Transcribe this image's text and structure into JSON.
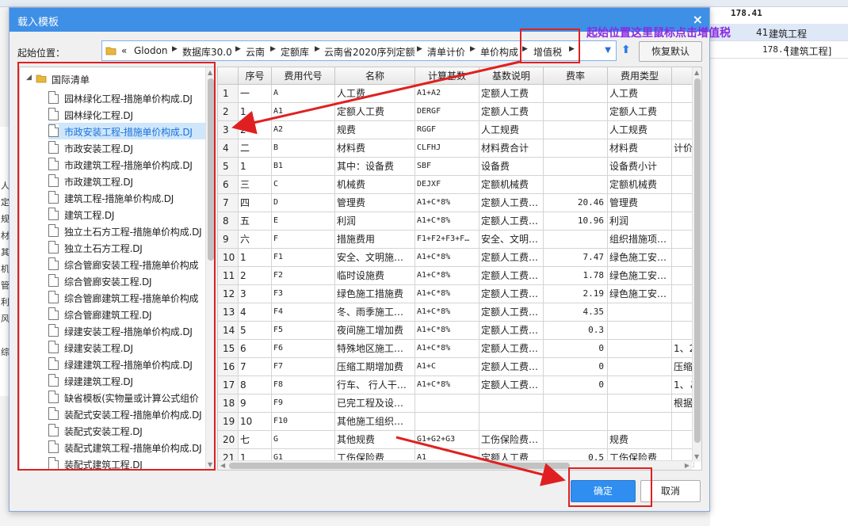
{
  "background": {
    "top_value": "178.41",
    "rows": [
      {
        "a": "41",
        "b": "建筑工程"
      },
      {
        "a": "178.4",
        "b": "[建筑工程]"
      }
    ],
    "left_labels": [
      "人",
      "定",
      "规",
      "材",
      "其",
      "机",
      "管",
      "利",
      "风",
      "",
      "综"
    ]
  },
  "dialog": {
    "title": "载入模板",
    "close_glyph": "×",
    "start_label": "起始位置：",
    "path": [
      "«",
      "Glodon",
      "数据库30.0",
      "云南",
      "定额库",
      "云南省2020序列定额",
      "清单计价",
      "单价构成",
      "增值税"
    ],
    "restore_label": "恢复默认",
    "ok_label": "确定",
    "cancel_label": "取消"
  },
  "tree": {
    "root": "国际清单",
    "items": [
      "园林绿化工程-措施单价构成.DJ",
      "园林绿化工程.DJ",
      "市政安装工程-措施单价构成.DJ",
      "市政安装工程.DJ",
      "市政建筑工程-措施单价构成.DJ",
      "市政建筑工程.DJ",
      "建筑工程-措施单价构成.DJ",
      "建筑工程.DJ",
      "独立土石方工程-措施单价构成.DJ",
      "独立土石方工程.DJ",
      "综合管廊安装工程-措施单价构成",
      "综合管廊安装工程.DJ",
      "综合管廊建筑工程-措施单价构成",
      "综合管廊建筑工程.DJ",
      "绿建安装工程-措施单价构成.DJ",
      "绿建安装工程.DJ",
      "绿建建筑工程-措施单价构成.DJ",
      "绿建建筑工程.DJ",
      "缺省模板(实物量或计算公式组价",
      "装配式安装工程-措施单价构成.DJ",
      "装配式安装工程.DJ",
      "装配式建筑工程-措施单价构成.DJ",
      "装配式建筑工程.DJ"
    ],
    "selected_index": 2
  },
  "grid": {
    "headers": [
      "序号",
      "费用代号",
      "名称",
      "计算基数",
      "基数说明",
      "费率",
      "费用类型",
      ""
    ],
    "rows": [
      [
        "1",
        "一",
        "A",
        "人工费",
        "A1+A2",
        "定额人工费",
        "",
        "人工费",
        ""
      ],
      [
        "2",
        "1",
        "A1",
        "定额人工费",
        "DERGF",
        "定额人工费",
        "",
        "定额人工费",
        ""
      ],
      [
        "3",
        "2",
        "A2",
        "规费",
        "RGGF",
        "人工规费",
        "",
        "人工规费",
        ""
      ],
      [
        "4",
        "二",
        "B",
        "材料费",
        "CLFHJ",
        "材料费合计",
        "",
        "材料费",
        "计价"
      ],
      [
        "5",
        "1",
        "B1",
        "其中：设备费",
        "SBF",
        "设备费",
        "",
        "设备费小计",
        ""
      ],
      [
        "6",
        "三",
        "C",
        "机械费",
        "DEJXF",
        "定额机械费",
        "",
        "定额机械费",
        ""
      ],
      [
        "7",
        "四",
        "D",
        "管理费",
        "A1+C*8%",
        "定额人工费…",
        "20.46",
        "管理费",
        ""
      ],
      [
        "8",
        "五",
        "E",
        "利润",
        "A1+C*8%",
        "定额人工费…",
        "10.96",
        "利润",
        ""
      ],
      [
        "9",
        "六",
        "F",
        "措施费用",
        "F1+F2+F3+F…",
        "安全、文明…",
        "",
        "组织措施项…",
        ""
      ],
      [
        "10",
        "1",
        "F1",
        "安全、文明施…",
        "A1+C*8%",
        "定额人工费…",
        "7.47",
        "绿色施工安…",
        ""
      ],
      [
        "11",
        "2",
        "F2",
        "临时设施费",
        "A1+C*8%",
        "定额人工费…",
        "1.78",
        "绿色施工安…",
        ""
      ],
      [
        "12",
        "3",
        "F3",
        "绿色施工措施费",
        "A1+C*8%",
        "定额人工费…",
        "2.19",
        "绿色施工安…",
        ""
      ],
      [
        "13",
        "4",
        "F4",
        "冬、雨季施工…",
        "A1+C*8%",
        "定额人工费…",
        "4.35",
        "",
        ""
      ],
      [
        "14",
        "5",
        "F5",
        "夜间施工增加费",
        "A1+C*8%",
        "定额人工费…",
        "0.3",
        "",
        ""
      ],
      [
        "15",
        "6",
        "F6",
        "特殊地区施工…",
        "A1+C*8%",
        "定额人工费…",
        "0",
        "",
        "1、2"
      ],
      [
        "16",
        "7",
        "F7",
        "压缩工期增加费",
        "A1+C",
        "定额人工费…",
        "0",
        "",
        "压缩"
      ],
      [
        "17",
        "8",
        "F8",
        "行车、 行人干…",
        "A1+C*8%",
        "定额人工费…",
        "0",
        "",
        "1、こ"
      ],
      [
        "18",
        "9",
        "F9",
        "已完工程及设…",
        "",
        "",
        "",
        "",
        "根据"
      ],
      [
        "19",
        "10",
        "F10",
        "其他施工组织…",
        "",
        "",
        "",
        "",
        ""
      ],
      [
        "20",
        "七",
        "G",
        "其他规费",
        "G1+G2+G3",
        "工伤保险费…",
        "",
        "规费",
        ""
      ],
      [
        "21",
        "1",
        "G1",
        "工伤保险费",
        "A1",
        "定额人工费",
        "0.5",
        "工伤保险费",
        ""
      ]
    ]
  },
  "annotation": {
    "text": "起始位置这里鼠标点击增值税"
  },
  "colors": {
    "titlebar": "#3e8fe6",
    "annotation_red": "#e02020",
    "annotation_text": "#8a2be2",
    "ok_button": "#2f8ef0",
    "selected_item": "#1a73d9"
  }
}
